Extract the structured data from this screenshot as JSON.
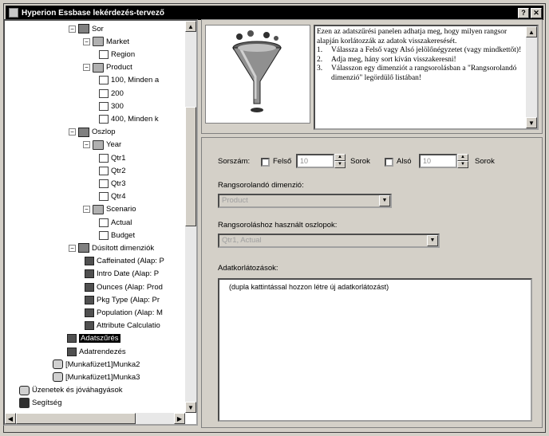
{
  "window": {
    "title": "Hyperion Essbase lekérdezés-tervező",
    "help_btn": "?",
    "close_btn": "✕"
  },
  "tree": {
    "items": [
      {
        "label": "Sor",
        "icon": "cube-icon",
        "exp": "−"
      },
      {
        "label": "Market",
        "icon": "folder-icon",
        "exp": "−"
      },
      {
        "label": "Region",
        "icon": "member-icon",
        "exp": ""
      },
      {
        "label": "Product",
        "icon": "folder-icon",
        "exp": "−"
      },
      {
        "label": "100, Minden a",
        "icon": "member-icon",
        "exp": ""
      },
      {
        "label": "200",
        "icon": "member-icon",
        "exp": ""
      },
      {
        "label": "300",
        "icon": "member-icon",
        "exp": ""
      },
      {
        "label": "400, Minden k",
        "icon": "member-icon",
        "exp": ""
      },
      {
        "label": "Oszlop",
        "icon": "cube-icon",
        "exp": "−"
      },
      {
        "label": "Year",
        "icon": "folder-icon",
        "exp": "−"
      },
      {
        "label": "Qtr1",
        "icon": "member-icon",
        "exp": ""
      },
      {
        "label": "Qtr2",
        "icon": "member-icon",
        "exp": ""
      },
      {
        "label": "Qtr3",
        "icon": "member-icon",
        "exp": ""
      },
      {
        "label": "Qtr4",
        "icon": "member-icon",
        "exp": ""
      },
      {
        "label": "Scenario",
        "icon": "folder-icon",
        "exp": "−"
      },
      {
        "label": "Actual",
        "icon": "member-icon",
        "exp": ""
      },
      {
        "label": "Budget",
        "icon": "member-icon",
        "exp": ""
      },
      {
        "label": "Dúsított dimenziók",
        "icon": "cube-icon",
        "exp": "−"
      },
      {
        "label": "Caffeinated (Alap: P",
        "icon": "attribute-icon",
        "exp": ""
      },
      {
        "label": "Intro Date (Alap: P",
        "icon": "attribute-icon",
        "exp": ""
      },
      {
        "label": "Ounces (Alap: Prod",
        "icon": "attribute-icon",
        "exp": ""
      },
      {
        "label": "Pkg Type (Alap: Pr",
        "icon": "attribute-icon",
        "exp": ""
      },
      {
        "label": "Population (Alap: M",
        "icon": "attribute-icon",
        "exp": ""
      },
      {
        "label": "Attribute Calculatio",
        "icon": "attribute-icon",
        "exp": ""
      },
      {
        "label": "Adatszűrés",
        "icon": "filter-icon",
        "exp": "",
        "selected": true
      },
      {
        "label": "Adatrendezés",
        "icon": "sort-icon",
        "exp": ""
      },
      {
        "label": "[Munkafüzet1]Munka2",
        "icon": "sheet-icon",
        "exp": ""
      },
      {
        "label": "[Munkafüzet1]Munka3",
        "icon": "sheet-icon",
        "exp": ""
      },
      {
        "label": "Üzenetek és jóváhagyások",
        "icon": "messages-icon",
        "exp": ""
      },
      {
        "label": "Segítség",
        "icon": "help-icon",
        "exp": ""
      }
    ]
  },
  "info": {
    "intro": "Ezen az adatszűrési panelen adhatja meg, hogy milyen rangsor alapján korlátozzák az adatok visszakeresését.",
    "steps": [
      {
        "num": "1.",
        "text": "Válassza a Felső vagy Alsó jelölőnégyzetet (vagy mindkettőt)!"
      },
      {
        "num": "2.",
        "text": "Adja meg, hány sort kíván visszakeresni!"
      },
      {
        "num": "3.",
        "text": "Válasszon egy dimenziót a rangsorolásban a \"Rangsorolandó dimenzió\" legördülő listában!"
      }
    ]
  },
  "settings": {
    "sorszam_label": "Sorszám:",
    "top_label": "Felső",
    "top_value": "10",
    "sorok_label": "Sorok",
    "bottom_label": "Alsó",
    "bottom_value": "10",
    "sorok_label2": "Sorok",
    "rank_dim_label": "Rangsorolandó dimenzió:",
    "rank_dim_value": "Product",
    "rank_col_label": "Rangsoroláshoz használt oszlopok:",
    "rank_col_value": "Qtr1, Actual",
    "filters_label": "Adatkorlátozások:",
    "filters_hint": "(dupla kattintással hozzon létre új adatkorlátozást)"
  }
}
